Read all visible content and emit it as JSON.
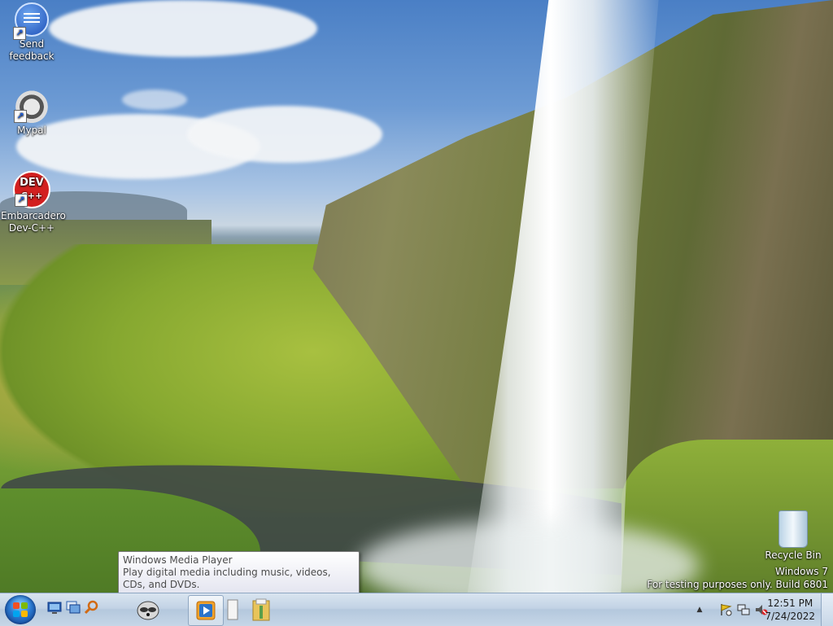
{
  "desktop": {
    "icons": [
      {
        "label": "Send\nfeedback",
        "line1": "Send",
        "line2": "feedback",
        "icon": "send-feedback-icon"
      },
      {
        "label": "Mypal",
        "line1": "Mypal",
        "icon": "mypal-raccoon-icon"
      },
      {
        "label": "Embarcadero Dev-C++",
        "line1": "Embarcadero",
        "line2": "Dev-C++",
        "icon": "devcpp-icon"
      },
      {
        "label": "Recycle Bin",
        "line1": "Recycle Bin",
        "icon": "recycle-bin-icon"
      }
    ],
    "dev_icon_text_1": "DEV",
    "dev_icon_text_2": "C++"
  },
  "watermark": {
    "line1": "Windows 7",
    "line2": "For testing purposes only. Build 6801"
  },
  "tooltip": {
    "title": "Windows Media Player",
    "description": "Play digital media including music, videos, CDs, and DVDs."
  },
  "taskbar": {
    "start_icon": "windows-start-orb-icon",
    "quick_launch": [
      "show-desktop-icon",
      "switch-windows-icon",
      "search-icon"
    ],
    "pinned": [
      "mypal-icon",
      "windows-media-player-icon",
      "blank-document-icon",
      "file-explorer-icon"
    ],
    "tray": [
      "show-hidden-icons-chevron",
      "action-center-flag-icon",
      "network-icon",
      "volume-muted-icon"
    ],
    "tray_chevron": "▲",
    "time": "12:51 PM",
    "date": "7/24/2022"
  },
  "colors": {
    "taskbar": "#c2d3e5",
    "start_orb": "#2a79d0",
    "tooltip_text": "#4c4c4c"
  }
}
